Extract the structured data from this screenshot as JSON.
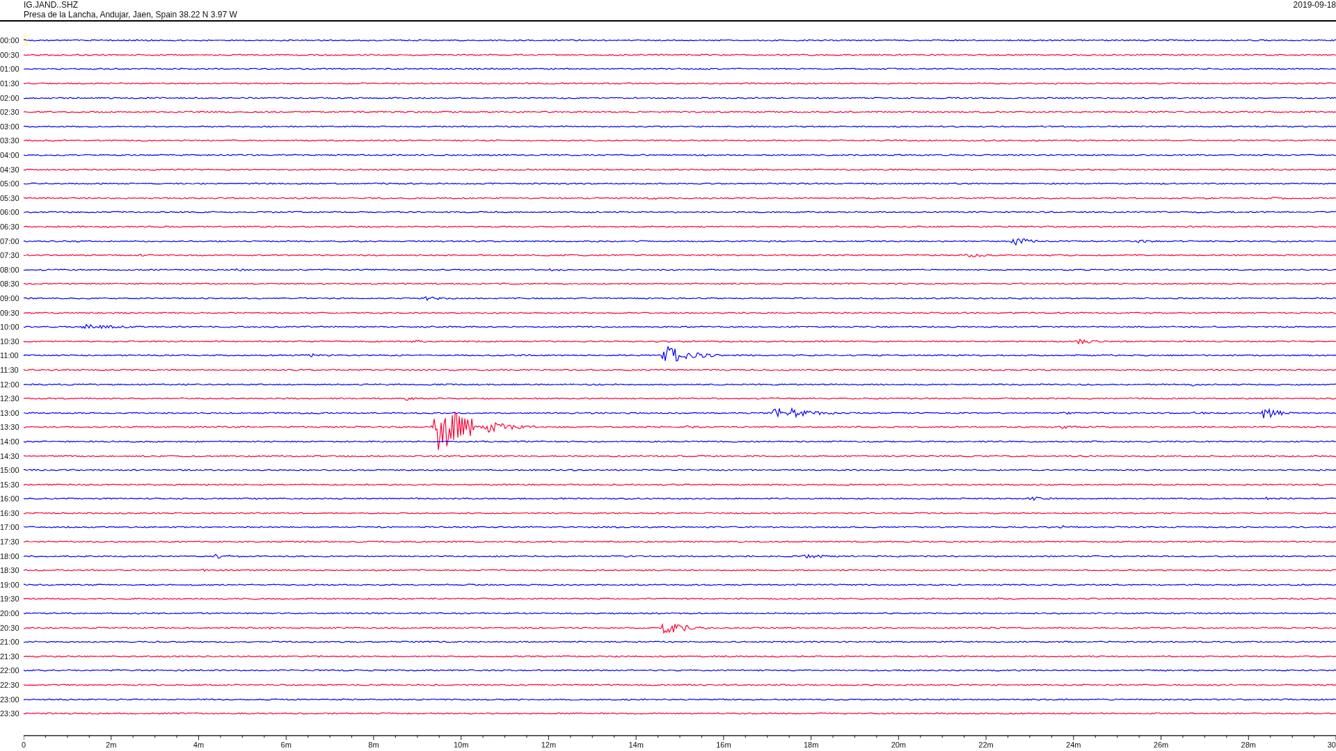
{
  "header": {
    "station": "IG.JAND..SHZ",
    "location": "Presa de la Lancha, Andujar, Jaen, Spain  38.22 N 3.97 W",
    "date": "2019-09-18"
  },
  "rows": [
    {
      "time": "00:00",
      "color": "#0000ff"
    },
    {
      "time": "00:30",
      "color": "#ff0033"
    },
    {
      "time": "01:00",
      "color": "#0000ff"
    },
    {
      "time": "01:30",
      "color": "#ff0033"
    },
    {
      "time": "02:00",
      "color": "#0000ff"
    },
    {
      "time": "02:30",
      "color": "#ff0033"
    },
    {
      "time": "03:00",
      "color": "#0000ff"
    },
    {
      "time": "03:30",
      "color": "#ff0033"
    },
    {
      "time": "04:00",
      "color": "#0000ff"
    },
    {
      "time": "04:30",
      "color": "#ff0033"
    },
    {
      "time": "05:00",
      "color": "#0000ff"
    },
    {
      "time": "05:30",
      "color": "#ff0033"
    },
    {
      "time": "06:00",
      "color": "#0000ff"
    },
    {
      "time": "06:30",
      "color": "#ff0033"
    },
    {
      "time": "07:00",
      "color": "#0000ff"
    },
    {
      "time": "07:30",
      "color": "#ff0033"
    },
    {
      "time": "08:00",
      "color": "#0000ff"
    },
    {
      "time": "08:30",
      "color": "#ff0033"
    },
    {
      "time": "09:00",
      "color": "#0000ff"
    },
    {
      "time": "09:30",
      "color": "#ff0033"
    },
    {
      "time": "10:00",
      "color": "#0000ff"
    },
    {
      "time": "10:30",
      "color": "#ff0033"
    },
    {
      "time": "11:00",
      "color": "#0000ff"
    },
    {
      "time": "11:30",
      "color": "#ff0033"
    },
    {
      "time": "12:00",
      "color": "#0000ff"
    },
    {
      "time": "12:30",
      "color": "#ff0033"
    },
    {
      "time": "13:00",
      "color": "#0000ff"
    },
    {
      "time": "13:30",
      "color": "#ff0033"
    },
    {
      "time": "14:00",
      "color": "#0000ff"
    },
    {
      "time": "14:30",
      "color": "#ff0033"
    },
    {
      "time": "15:00",
      "color": "#0000ff"
    },
    {
      "time": "15:30",
      "color": "#ff0033"
    },
    {
      "time": "16:00",
      "color": "#0000ff"
    },
    {
      "time": "16:30",
      "color": "#ff0033"
    },
    {
      "time": "17:00",
      "color": "#0000ff"
    },
    {
      "time": "17:30",
      "color": "#ff0033"
    },
    {
      "time": "18:00",
      "color": "#0000ff"
    },
    {
      "time": "18:30",
      "color": "#ff0033"
    },
    {
      "time": "19:00",
      "color": "#0000ff"
    },
    {
      "time": "19:30",
      "color": "#ff0033"
    },
    {
      "time": "20:00",
      "color": "#0000ff"
    },
    {
      "time": "20:30",
      "color": "#ff0033"
    },
    {
      "time": "21:00",
      "color": "#0000ff"
    },
    {
      "time": "21:30",
      "color": "#ff0033"
    },
    {
      "time": "22:00",
      "color": "#0000ff"
    },
    {
      "time": "22:30",
      "color": "#ff0033"
    },
    {
      "time": "23:00",
      "color": "#0000ff"
    },
    {
      "time": "23:30",
      "color": "#ff0033"
    }
  ],
  "axis": {
    "labels": [
      "0",
      "2m",
      "4m",
      "6m",
      "8m",
      "10m",
      "12m",
      "14m",
      "16m",
      "18m",
      "20m",
      "22m",
      "24m",
      "26m",
      "28m",
      "30"
    ]
  }
}
